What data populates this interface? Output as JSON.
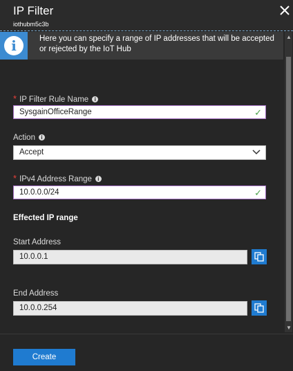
{
  "header": {
    "title": "IP Filter",
    "subtitle": "iothubm5c3b"
  },
  "info": {
    "text": "Here you can specify a range of IP addresses that will be accepted or rejected by the IoT Hub"
  },
  "form": {
    "rule_name_label": "IP Filter Rule Name",
    "rule_name_value": "SysgainOfficeRange",
    "action_label": "Action",
    "action_value": "Accept",
    "range_label": "IPv4 Address Range",
    "range_value": "10.0.0.0/24",
    "required_marker": "*",
    "help_glyph": "i"
  },
  "effected": {
    "title": "Effected IP range",
    "start_label": "Start Address",
    "start_value": "10.0.0.1",
    "end_label": "End Address",
    "end_value": "10.0.0.254"
  },
  "footer": {
    "create_label": "Create"
  },
  "colors": {
    "background": "#262626",
    "accent": "#1f7bd0",
    "valid_border": "#a46fc3",
    "check": "#4aa24a",
    "required": "#e8403a"
  }
}
